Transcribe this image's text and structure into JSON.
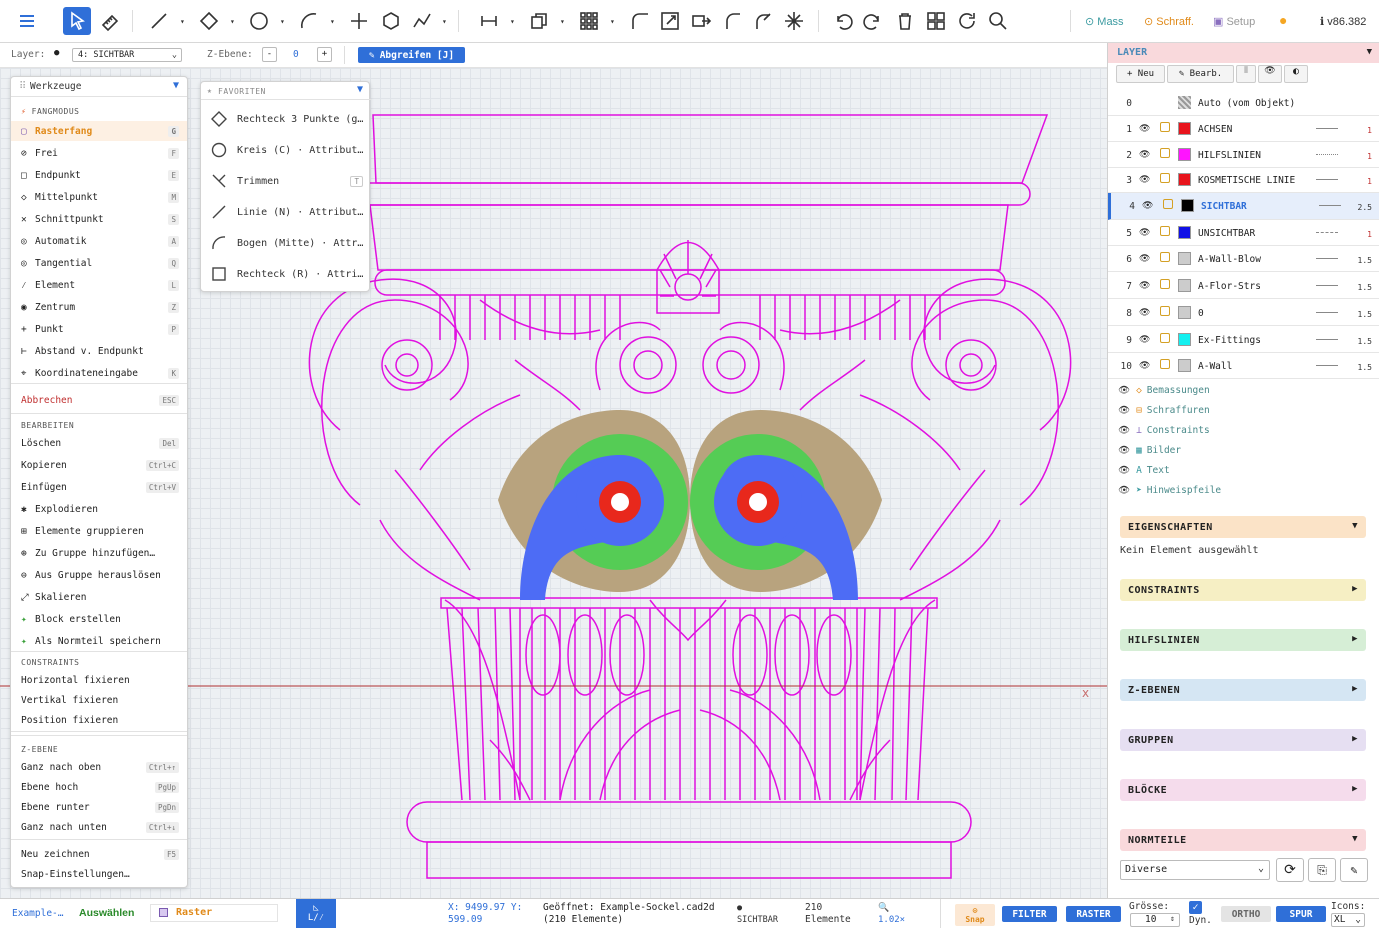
{
  "toolbar": {
    "mass": "Mass",
    "schraff": "Schraff.",
    "setup": "Setup",
    "version": "v86.382"
  },
  "bar2": {
    "layer_label": "Layer:",
    "layer_value": "4: SICHTBAR",
    "z_label": "Z-Ebene:",
    "z_minus": "-",
    "z_value": "0",
    "z_plus": "+",
    "abgreifen": "Abgreifen [J]"
  },
  "tools": {
    "title": "Werkzeuge",
    "fangmodus": "FANGMODUS",
    "snap": [
      {
        "label": "Rasterfang",
        "key": "G",
        "icon": "grid-icon"
      },
      {
        "label": "Frei",
        "key": "F",
        "icon": "free-icon"
      },
      {
        "label": "Endpunkt",
        "key": "E",
        "icon": "endpoint-icon"
      },
      {
        "label": "Mittelpunkt",
        "key": "M",
        "icon": "midpoint-icon"
      },
      {
        "label": "Schnittpunkt",
        "key": "S",
        "icon": "intersection-icon"
      },
      {
        "label": "Automatik",
        "key": "A",
        "icon": "auto-icon"
      },
      {
        "label": "Tangential",
        "key": "Q",
        "icon": "tangent-icon"
      },
      {
        "label": "Element",
        "key": "L",
        "icon": "element-icon"
      },
      {
        "label": "Zentrum",
        "key": "Z",
        "icon": "center-icon"
      },
      {
        "label": "Punkt",
        "key": "P",
        "icon": "point-icon"
      },
      {
        "label": "Abstand v. Endpunkt",
        "key": "",
        "icon": "distance-icon"
      },
      {
        "label": "Koordinateneingabe",
        "key": "K",
        "icon": "coordinate-icon"
      }
    ],
    "abbrechen": "Abbrechen",
    "abbrechen_key": "ESC",
    "bearbeiten": "BEARBEITEN",
    "edit": [
      {
        "label": "Löschen",
        "key": "Del"
      },
      {
        "label": "Kopieren",
        "key": "Ctrl+C"
      },
      {
        "label": "Einfügen",
        "key": "Ctrl+V"
      },
      {
        "label": "Explodieren",
        "key": ""
      },
      {
        "label": "Elemente gruppieren",
        "key": ""
      },
      {
        "label": "Zu Gruppe hinzufügen…",
        "key": ""
      },
      {
        "label": "Aus Gruppe herauslösen",
        "key": ""
      },
      {
        "label": "Skalieren",
        "key": ""
      },
      {
        "label": "Block erstellen",
        "key": ""
      },
      {
        "label": "Als Normteil speichern",
        "key": ""
      }
    ],
    "constraints": "CONSTRAINTS",
    "constraint_items": [
      "Horizontal fixieren",
      "Vertikal fixieren",
      "Position fixieren"
    ],
    "zebene": "Z-EBENE",
    "z_items": [
      {
        "label": "Ganz nach oben",
        "key": "Ctrl+↑"
      },
      {
        "label": "Ebene hoch",
        "key": "PgUp"
      },
      {
        "label": "Ebene runter",
        "key": "PgDn"
      },
      {
        "label": "Ganz nach unten",
        "key": "Ctrl+↓"
      }
    ],
    "neu_zeichnen": "Neu zeichnen",
    "neu_key": "F5",
    "snap_settings": "Snap-Einstellungen…"
  },
  "favorites": {
    "title": "FAVORITEN",
    "items": [
      "Rechteck 3 Punkte (g…",
      "Kreis (C) · Attribut…",
      "Trimmen",
      "Linie (N) · Attribut…",
      "Bogen (Mitte) · Attr…",
      "Rechteck (R) · Attri…"
    ],
    "trim_key": "T"
  },
  "layers": {
    "title": "LAYER",
    "btn_new": "Neu",
    "btn_edit": "Bearb.",
    "auto_num": "0",
    "auto_label": "Auto (vom Objekt)",
    "rows": [
      {
        "num": "1",
        "name": "ACHSEN",
        "color": "#e8141c",
        "lw": "1"
      },
      {
        "num": "2",
        "name": "HILFSLINIEN",
        "color": "#ff14ff",
        "lw": "1"
      },
      {
        "num": "3",
        "name": "KOSMETISCHE LINIE",
        "color": "#e8141c",
        "lw": "1"
      },
      {
        "num": "4",
        "name": "SICHTBAR",
        "color": "#000000",
        "lw": "2.5"
      },
      {
        "num": "5",
        "name": "UNSICHTBAR",
        "color": "#1010e6",
        "lw": "1"
      },
      {
        "num": "6",
        "name": "A-Wall-Blow",
        "color": "#cccccc",
        "lw": "1.5"
      },
      {
        "num": "7",
        "name": "A-Flor-Strs",
        "color": "#cccccc",
        "lw": "1.5"
      },
      {
        "num": "8",
        "name": "0",
        "color": "#cccccc",
        "lw": "1.5"
      },
      {
        "num": "9",
        "name": "Ex-Fittings",
        "color": "#14f0f0",
        "lw": "1.5"
      },
      {
        "num": "10",
        "name": "A-Wall",
        "color": "#cccccc",
        "lw": "1.5"
      }
    ],
    "overlays": [
      {
        "label": "Bemassungen",
        "icon": "dimension-icon"
      },
      {
        "label": "Schraffuren",
        "icon": "hatch-icon"
      },
      {
        "label": "Constraints",
        "icon": "constraint-icon"
      },
      {
        "label": "Bilder",
        "icon": "image-icon"
      },
      {
        "label": "Text",
        "icon": "text-icon"
      },
      {
        "label": "Hinweispfeile",
        "icon": "arrow-icon"
      }
    ]
  },
  "sections": {
    "eigenschaften": "EIGENSCHAFTEN",
    "kein_element": "Kein Element ausgewählt",
    "constraints": "CONSTRAINTS",
    "hilfslinien": "HILFSLINIEN",
    "zebenen": "Z-EBENEN",
    "gruppen": "GRUPPEN",
    "bloecke": "BLÖCKE",
    "normteile": "NORMTEILE",
    "normteile_select": "Diverse"
  },
  "status": {
    "file_tab": "Example-…",
    "auswaehlen": "Auswählen",
    "raster": "Raster",
    "mode": "L/⁄",
    "coords": "X: 9499.97 Y: 599.09",
    "opened": "Geöffnet: Example-Sockel.cad2d (210 Elemente)",
    "layer": "SICHTBAR",
    "elements": "210 Elemente",
    "zoom": "1.02×",
    "snap": "Snap",
    "filter": "FILTER",
    "raster_btn": "RASTER",
    "ortho": "ORTHO",
    "spur": "SPUR",
    "groesse_label": "Grösse:",
    "groesse_value": "10",
    "dyn_label": "Dyn.",
    "icons_label": "Icons:",
    "icons_value": "XL"
  },
  "colors": {
    "accent": "#2f6fd8",
    "magenta": "#e010e0",
    "tan": "#b8a37e",
    "green": "#55cc55",
    "blue": "#4d6cf5",
    "red": "#e8281c"
  }
}
